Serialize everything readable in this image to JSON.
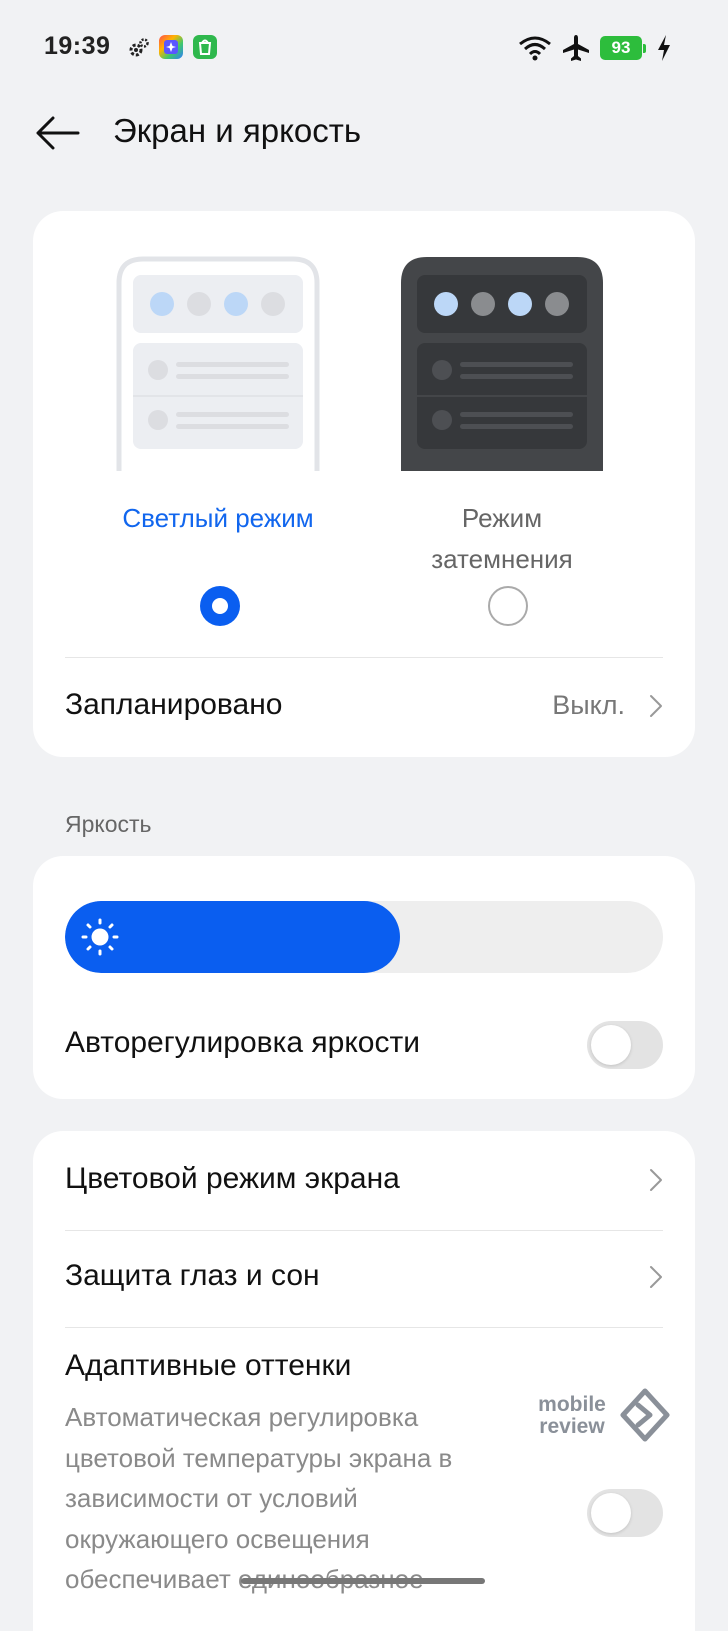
{
  "status_bar": {
    "time": "19:39",
    "notification_icons": [
      "settings-gear-icon",
      "app-launcher-icon",
      "app-store-icon"
    ],
    "indicators": [
      "wifi-icon",
      "airplane-mode-icon"
    ],
    "battery_level": "93",
    "charging": true
  },
  "header": {
    "title": "Экран и яркость"
  },
  "theme": {
    "light_label": "Светлый режим",
    "dark_label": "Режим затемнения",
    "selected": "light"
  },
  "schedule": {
    "label": "Запланировано",
    "value": "Выкл."
  },
  "brightness": {
    "section_label": "Яркость",
    "level_percent": 56,
    "auto_label": "Авторегулировка яркости",
    "auto_enabled": false
  },
  "list": {
    "color_mode_label": "Цветовой режим экрана",
    "eye_comfort_label": "Защита глаз и сон",
    "adaptive_title": "Адаптивные оттенки",
    "adaptive_desc": "Автоматическая регулировка цветовой температуры экрана в зависимости от условий окружающего освещения обеспечивает единообразное",
    "adaptive_enabled": false
  },
  "watermark": {
    "line1": "mobile",
    "line2": "review"
  },
  "colors": {
    "accent": "#0a5ef0",
    "background": "#f1f2f4",
    "card": "#ffffff",
    "battery": "#2dbd3c"
  }
}
